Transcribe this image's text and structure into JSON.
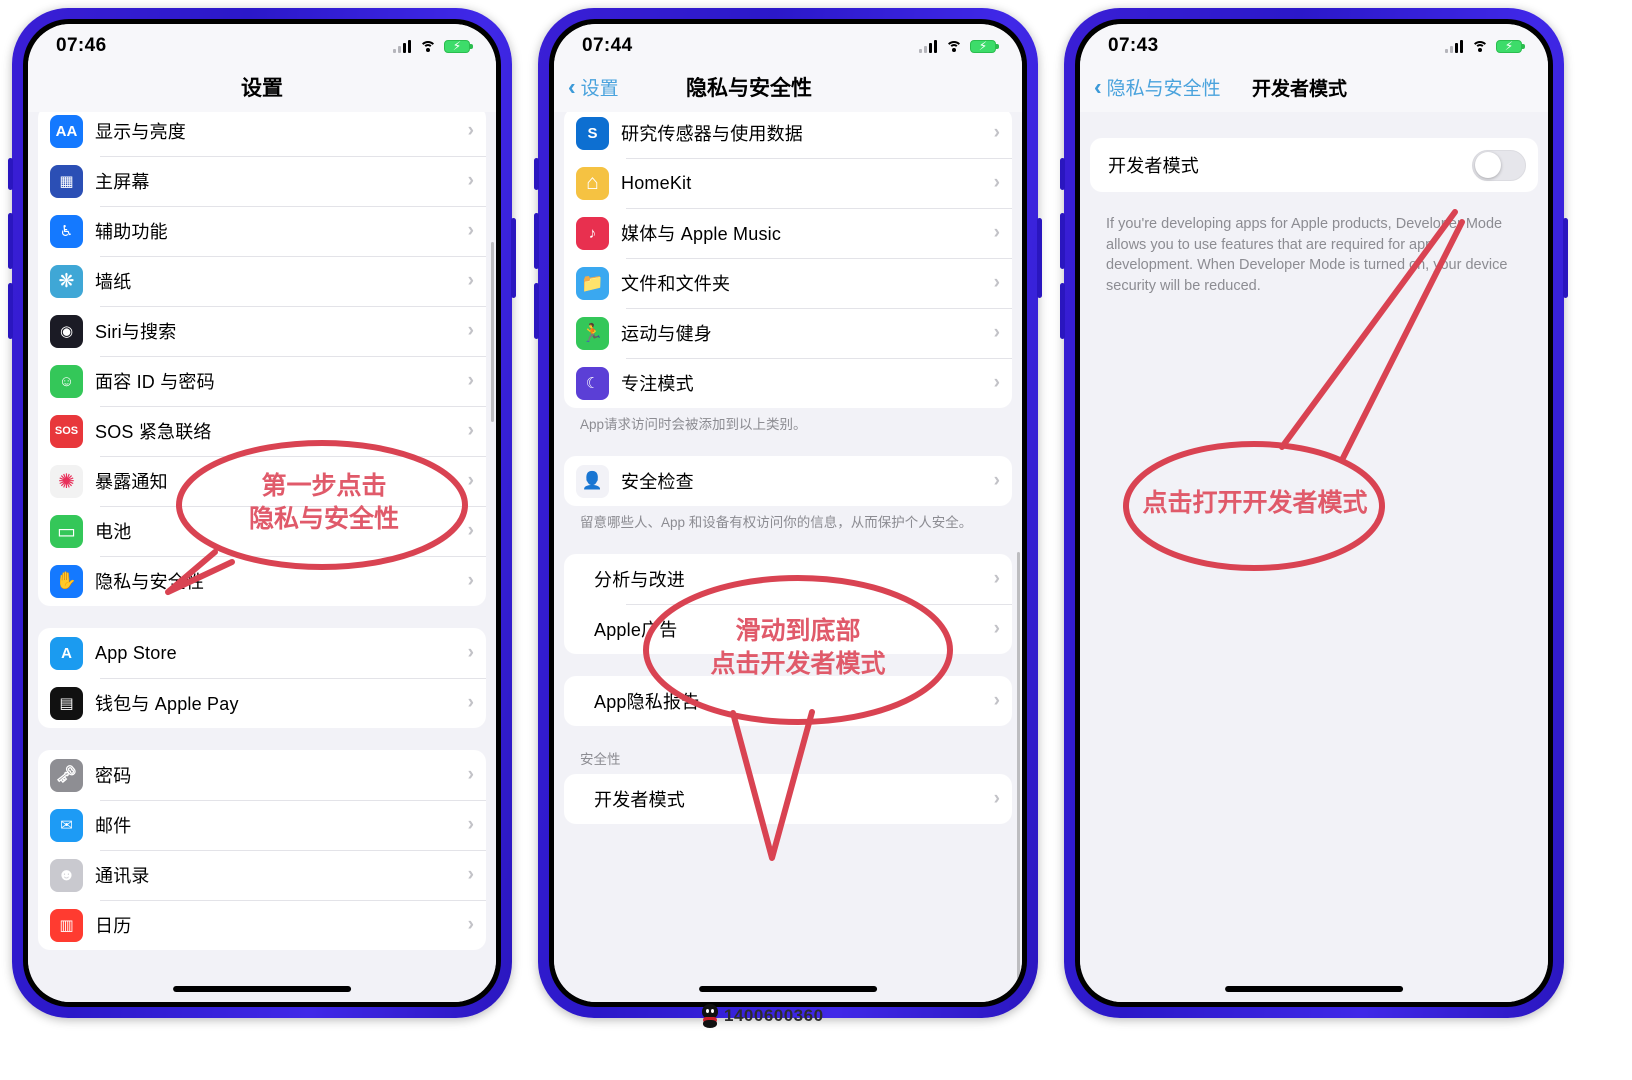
{
  "page": {
    "watermark_number": "1400600360",
    "annotation_color": "#d94352",
    "annotation_text_color": "#e05a6a"
  },
  "phones": [
    {
      "id": "phone-settings",
      "status": {
        "time": "07:46",
        "signal_icon": "signal-bars-icon",
        "wifi_icon": "wifi-icon",
        "battery_icon": "battery-charging-icon"
      },
      "nav": {
        "title": "设置",
        "back_label": null
      },
      "groups": [
        {
          "rows": [
            {
              "label": "显示与亮度",
              "icon": "display-brightness-icon"
            },
            {
              "label": "主屏幕",
              "icon": "home-screen-icon"
            },
            {
              "label": "辅助功能",
              "icon": "accessibility-icon"
            },
            {
              "label": "墙纸",
              "icon": "wallpaper-icon"
            },
            {
              "label": "Siri与搜索",
              "icon": "siri-icon"
            },
            {
              "label": "面容 ID 与密码",
              "icon": "face-id-icon"
            },
            {
              "label": "SOS 紧急联络",
              "icon": "sos-icon"
            },
            {
              "label": "暴露通知",
              "icon": "exposure-notification-icon"
            },
            {
              "label": "电池",
              "icon": "battery-icon"
            },
            {
              "label": "隐私与安全性",
              "icon": "privacy-hand-icon"
            }
          ]
        },
        {
          "rows": [
            {
              "label": "App Store",
              "icon": "app-store-icon"
            },
            {
              "label": "钱包与 Apple Pay",
              "icon": "wallet-icon"
            }
          ]
        },
        {
          "rows": [
            {
              "label": "密码",
              "icon": "passwords-key-icon"
            },
            {
              "label": "邮件",
              "icon": "mail-icon"
            },
            {
              "label": "通讯录",
              "icon": "contacts-icon"
            },
            {
              "label": "日历",
              "icon": "calendar-icon"
            }
          ]
        }
      ],
      "annotation": {
        "line1": "第一步点击",
        "line2": "隐私与安全性"
      }
    },
    {
      "id": "phone-privacy",
      "status": {
        "time": "07:44",
        "signal_icon": "signal-bars-icon",
        "wifi_icon": "wifi-icon",
        "battery_icon": "battery-charging-icon"
      },
      "nav": {
        "title": "隐私与安全性",
        "back_label": "设置"
      },
      "groups": [
        {
          "rows": [
            {
              "label": "研究传感器与使用数据",
              "icon": "research-sensor-icon"
            },
            {
              "label": "HomeKit",
              "icon": "homekit-icon"
            },
            {
              "label": "媒体与 Apple Music",
              "icon": "apple-music-icon"
            },
            {
              "label": "文件和文件夹",
              "icon": "files-folder-icon"
            },
            {
              "label": "运动与健身",
              "icon": "fitness-icon"
            },
            {
              "label": "专注模式",
              "icon": "focus-moon-icon"
            }
          ],
          "footnote": "App请求访问时会被添加到以上类别。"
        },
        {
          "rows": [
            {
              "label": "安全检查",
              "icon": "safety-check-icon"
            }
          ],
          "footnote": "留意哪些人、App 和设备有权访问你的信息，从而保护个人安全。"
        },
        {
          "rows": [
            {
              "label": "分析与改进",
              "icon": null
            },
            {
              "label": "Apple广告",
              "icon": null
            }
          ]
        },
        {
          "rows": [
            {
              "label": "App隐私报告",
              "icon": null
            }
          ]
        },
        {
          "header": "安全性",
          "rows": [
            {
              "label": "开发者模式",
              "icon": null
            }
          ]
        }
      ],
      "annotation": {
        "line1": "滑动到底部",
        "line2": "点击开发者模式"
      }
    },
    {
      "id": "phone-developer-mode",
      "status": {
        "time": "07:43",
        "signal_icon": "signal-bars-icon",
        "wifi_icon": "wifi-icon",
        "battery_icon": "battery-charging-icon"
      },
      "nav": {
        "title": "开发者模式",
        "back_label": "隐私与安全性"
      },
      "toggle_row": {
        "label": "开发者模式",
        "state": "off"
      },
      "description": "If you're developing apps for Apple products, Developer Mode allows you to use features that are required for app development. When Developer Mode is turned on, your device security will be reduced.",
      "annotation": {
        "line1": "点击打开开发者模式"
      }
    }
  ]
}
